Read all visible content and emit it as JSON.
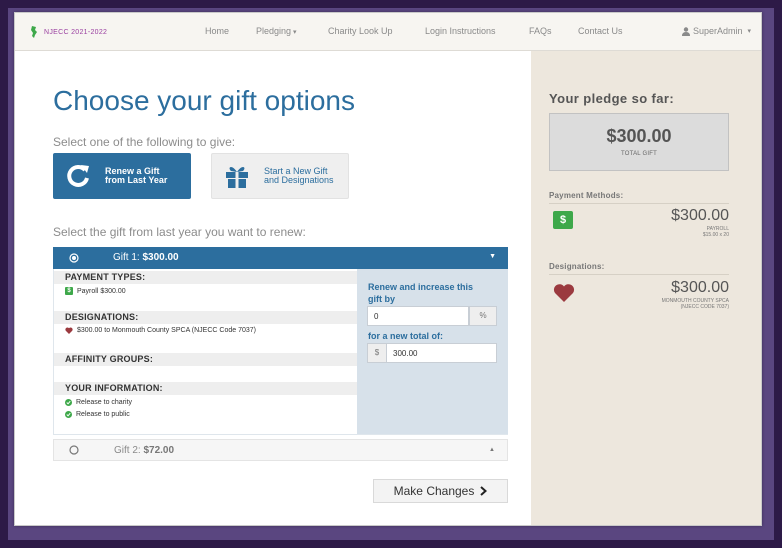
{
  "navbar": {
    "logo_text": "NJECC 2021-2022",
    "items": [
      "Home",
      "Pledging",
      "Charity Look Up",
      "Login Instructions",
      "FAQs",
      "Contact Us"
    ],
    "user": "SuperAdmin",
    "caret": "▾"
  },
  "main": {
    "title": "Choose your gift options",
    "subtitle": "Select one of the following to give:",
    "option_renew": "Renew a Gift from Last Year",
    "option_new": "Start a New Gift and Designations",
    "select_label": "Select the gift from last year you want to renew:",
    "gift1": {
      "label": "Gift 1:",
      "amount": "$300.00",
      "payment_types_head": "PAYMENT TYPES:",
      "payment_item": "Payroll $300.00",
      "designations_head": "DESIGNATIONS:",
      "designation_item": "$300.00 to Monmouth County SPCA (NJECC Code 7037)",
      "affinity_head": "AFFINITY GROUPS:",
      "info_head": "YOUR INFORMATION:",
      "info_items": [
        "Release to charity",
        "Release to public"
      ],
      "renew_label": "Renew and increase this gift by",
      "increase_value": "0",
      "percent_sign": "%",
      "new_total_label": "for a new total of:",
      "dollar_sign": "$",
      "new_total_value": "300.00"
    },
    "gift2": {
      "label": "Gift 2:",
      "amount": "$72.00"
    },
    "make_changes": "Make Changes"
  },
  "side": {
    "pledge_title": "Your pledge so far:",
    "total_amount": "$300.00",
    "total_label": "TOTAL GIFT",
    "payment_methods": "Payment Methods:",
    "pm_amount": "$300.00",
    "pm_sub1": "PAYROLL",
    "pm_sub2": "$15.00 x 20",
    "designations": "Designations:",
    "des_amount": "$300.00",
    "des_sub1": "MONMOUTH COUNTY SPCA",
    "des_sub2": "(NJECC CODE 7037)"
  },
  "colors": {
    "primary": "#2c6e9e",
    "success": "#3ea84a",
    "heart": "#9b3a3f",
    "side_bg": "#ede7dd",
    "outer_bg": "#2d1a47"
  }
}
